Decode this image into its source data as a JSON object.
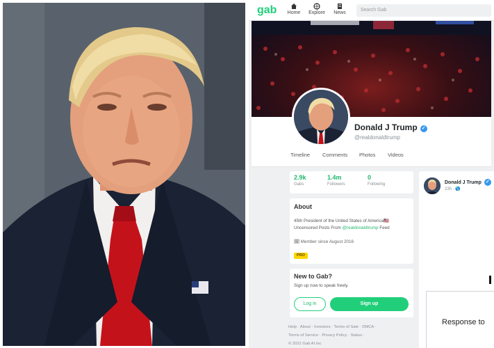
{
  "app": {
    "logo": "gab"
  },
  "nav": [
    {
      "label": "Home",
      "icon": "home-icon"
    },
    {
      "label": "Explore",
      "icon": "globe-icon"
    },
    {
      "label": "News",
      "icon": "news-icon"
    }
  ],
  "search": {
    "placeholder": "Search Gab"
  },
  "profile": {
    "name": "Donald J Trump",
    "handle": "@realdonaldtrump",
    "verified_color": "#3898ec"
  },
  "tabs": [
    "Timeline",
    "Comments",
    "Photos",
    "Videos"
  ],
  "stats": [
    {
      "value": "2.9k",
      "label": "Gabs"
    },
    {
      "value": "1.4m",
      "label": "Followers"
    },
    {
      "value": "0",
      "label": "Following"
    }
  ],
  "about": {
    "title": "About",
    "bio_line1": "45th President of the United States of America🇺🇸",
    "bio_line2_pre": "Uncensored Posts From ",
    "bio_link": "@realdonaldtrump",
    "bio_line2_post": " Feed",
    "member_since": "Member since August 2016",
    "badge": "PRO"
  },
  "new_to_gab": {
    "title": "New to Gab?",
    "subtitle": "Sign up now to speak freely.",
    "login": "Log in",
    "signup": "Sign up"
  },
  "footer": {
    "line1": "Help · About · Investors · Terms of Sale · DMCA ·",
    "line2": "Terms of Service · Privacy Policy · Status ·",
    "line3": "© 2021 Gab AI Inc"
  },
  "post": {
    "author": "Donald J Trump",
    "time": "23h · 🌎",
    "embed_text": "Response to"
  },
  "colors": {
    "brand_green": "#21cf7a",
    "pro_yellow": "#ffd400"
  }
}
